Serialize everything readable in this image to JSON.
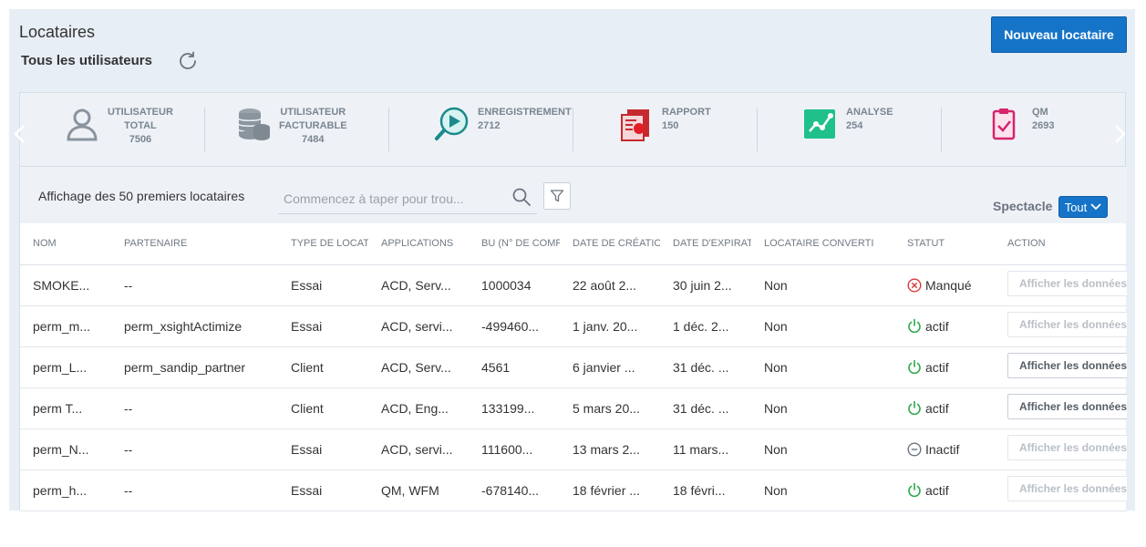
{
  "header": {
    "title": "Locataires",
    "subtitle": "Tous les utilisateurs",
    "new_button": "Nouveau locataire"
  },
  "stats": [
    {
      "line1": "UTILISATEUR",
      "line2": "TOTAL",
      "value": "7506",
      "icon": "user-icon"
    },
    {
      "line1": "UTILISATEUR",
      "line2": "FACTURABLE",
      "value": "7484",
      "icon": "coins-icon"
    },
    {
      "line1": "ENREGISTREMENT",
      "value": "2712",
      "icon": "recording-play-icon"
    },
    {
      "line1": "RAPPORT",
      "value": "150",
      "icon": "report-icon"
    },
    {
      "line1": "ANALYSE",
      "value": "254",
      "icon": "analytics-icon"
    },
    {
      "line1": "QM",
      "value": "2693",
      "icon": "clipboard-check-icon"
    }
  ],
  "toolbar": {
    "label": "Affichage des 50 premiers locataires",
    "search_placeholder": "Commencez à taper pour trou...",
    "spectacle_label": "Spectacle",
    "spectacle_value": "Tout"
  },
  "table": {
    "columns": [
      "NOM",
      "PARTENAIRE",
      "TYPE DE LOCATA",
      "APPLICATIONS",
      "BU (N° DE COMP",
      "DATE DE CRÉATION",
      "DATE D'EXPIRATI",
      "LOCATAIRE CONVERTI",
      "STATUT",
      "ACTION"
    ],
    "rows": [
      {
        "nom": "SMOKE...",
        "partenaire": "--",
        "type": "Essai",
        "applications": "ACD, Serv...",
        "bu": "1000034",
        "creation": "22 août 2...",
        "expiration": "30 juin 2...",
        "converti": "Non",
        "statut": "Manqué",
        "statut_kind": "error",
        "action": "Afficher les données",
        "action_enabled": false
      },
      {
        "nom": "perm_m...",
        "partenaire": "perm_xsightActimize",
        "type": "Essai",
        "applications": "ACD, servi...",
        "bu": "-499460...",
        "creation": "1 janv. 20...",
        "expiration": "1 déc. 2...",
        "converti": "Non",
        "statut": "actif",
        "statut_kind": "active",
        "action": "Afficher les données",
        "action_enabled": false
      },
      {
        "nom": "perm_L...",
        "partenaire": "perm_sandip_partner",
        "type": "Client",
        "applications": "ACD, Serv...",
        "bu": "4561",
        "creation": "6 janvier ...",
        "expiration": "31 déc. ...",
        "converti": "Non",
        "statut": "actif",
        "statut_kind": "active",
        "action": "Afficher les données",
        "action_enabled": true
      },
      {
        "nom": "perm T...",
        "partenaire": "--",
        "type": "Client",
        "applications": "ACD, Eng...",
        "bu": "133199...",
        "creation": "5 mars 20...",
        "expiration": "31 déc. ...",
        "converti": "Non",
        "statut": "actif",
        "statut_kind": "active",
        "action": "Afficher les données",
        "action_enabled": true
      },
      {
        "nom": "perm_N...",
        "partenaire": "--",
        "type": "Essai",
        "applications": "ACD, servi...",
        "bu": "111600...",
        "creation": "13 mars 2...",
        "expiration": "11 mars...",
        "converti": "Non",
        "statut": "Inactif",
        "statut_kind": "inactive",
        "action": "Afficher les données",
        "action_enabled": false
      },
      {
        "nom": "perm_h...",
        "partenaire": "--",
        "type": "Essai",
        "applications": "QM, WFM",
        "bu": "-678140...",
        "creation": "18 février ...",
        "expiration": "18 févri...",
        "converti": "Non",
        "statut": "actif",
        "statut_kind": "active",
        "action": "Afficher les données",
        "action_enabled": false
      }
    ]
  },
  "colors": {
    "primary": "#1574c7",
    "active_green": "#2aa84a",
    "error_red": "#d9383a",
    "inactive_grey": "#6b7380"
  }
}
